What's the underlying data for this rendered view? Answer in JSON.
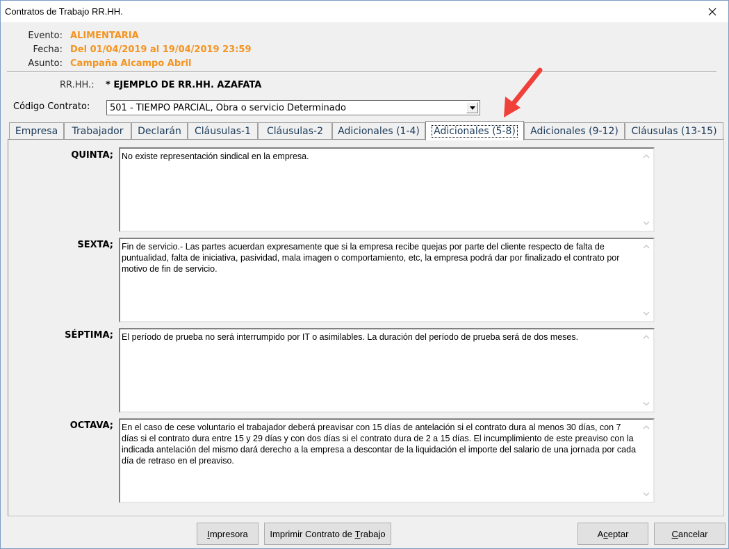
{
  "window": {
    "title": "Contratos de Trabajo RR.HH."
  },
  "header": {
    "evento_label": "Evento:",
    "evento_value": "ALIMENTARIA",
    "fecha_label": "Fecha:",
    "fecha_value": "Del 01/04/2019 al 19/04/2019 23:59",
    "asunto_label": "Asunto:",
    "asunto_value": "Campaña Alcampo Abril",
    "accent_color": "#f39420"
  },
  "rrhh": {
    "label": "RR.HH.:",
    "value": "* EJEMPLO DE RR.HH. AZAFATA"
  },
  "codigo": {
    "label": "Código Contrato:",
    "selected": "501 - TIEMPO PARCIAL, Obra o servicio Determinado"
  },
  "tabs": [
    {
      "label": "Empresa",
      "active": false
    },
    {
      "label": "Trabajador",
      "active": false
    },
    {
      "label": "Declarán",
      "active": false
    },
    {
      "label": "Cláusulas-1",
      "active": false
    },
    {
      "label": "Cláusulas-2",
      "active": false
    },
    {
      "label": "Adicionales (1-4)",
      "active": false
    },
    {
      "label": "Adicionales (5-8)",
      "active": true
    },
    {
      "label": "Adicionales (9-12)",
      "active": false
    },
    {
      "label": "Cláusulas (13-15)",
      "active": false
    }
  ],
  "clauses": [
    {
      "label": "QUINTA;",
      "text": "No existe representación sindical en la empresa."
    },
    {
      "label": "SEXTA;",
      "text": "Fin de servicio.- Las partes acuerdan expresamente que si la empresa recibe quejas por parte del cliente respecto de falta de puntualidad, falta de iniciativa, pasividad, mala imagen o comportamiento,  etc, la empresa podrá dar por finalizado el contrato por motivo de fin de servicio."
    },
    {
      "label": "SÉPTIMA;",
      "text": "El período de prueba no será interrumpido por IT o asimilables. La duración del período de prueba será de dos meses."
    },
    {
      "label": "OCTAVA;",
      "text": "En el caso de cese voluntario el trabajador deberá preavisar con 15 días de antelación si el contrato dura al menos 30 días, con 7 días si el contrato dura entre 15 y 29 días y con dos días si el contrato dura de 2 a 15 días. El incumplimiento de este preaviso con la indicada antelación del mismo dará derecho a la empresa a descontar de la liquidación el importe del salario de una jornada por cada día de retraso en el preaviso."
    }
  ],
  "buttons": {
    "impresora_pre": "",
    "impresora_u": "I",
    "impresora_post": "mpresora",
    "imprimir_pre": "Imprimir Contrato de ",
    "imprimir_u": "T",
    "imprimir_post": "rabajo",
    "aceptar_pre": "A",
    "aceptar_u": "c",
    "aceptar_post": "eptar",
    "cancelar_pre": "",
    "cancelar_u": "C",
    "cancelar_post": "ancelar"
  },
  "annotation": {
    "arrow_color": "#f0403a",
    "points_to": "Adicionales (5-8)"
  }
}
